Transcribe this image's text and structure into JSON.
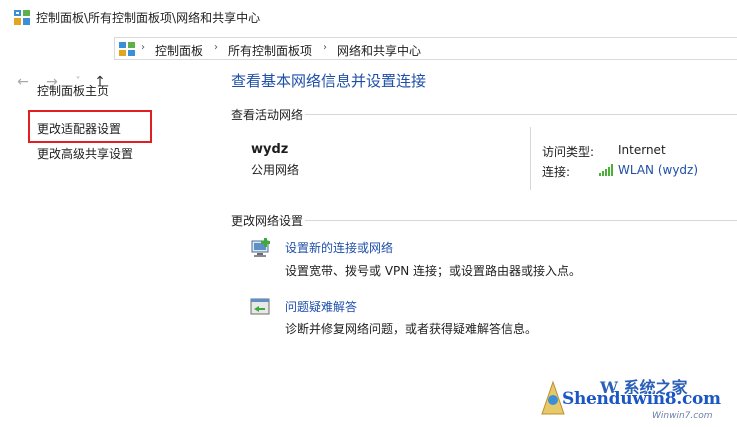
{
  "window": {
    "title": "控制面板\\所有控制面板项\\网络和共享中心"
  },
  "nav": {
    "back": "←",
    "forward": "→",
    "recent": "˅",
    "up": "↑"
  },
  "address": {
    "crumbs": [
      "控制面板",
      "所有控制面板项",
      "网络和共享中心"
    ],
    "separator": "›"
  },
  "sidebar": {
    "items": [
      "控制面板主页",
      "更改适配器设置",
      "更改高级共享设置"
    ]
  },
  "main": {
    "heading": "查看基本网络信息并设置连接",
    "active_label": "查看活动网络",
    "network": {
      "name": "wydz",
      "type": "公用网络",
      "access_label": "访问类型:",
      "access_value": "Internet",
      "conn_label": "连接:",
      "conn_value": "WLAN (wydz)"
    },
    "change_label": "更改网络设置",
    "tasks": [
      {
        "title": "设置新的连接或网络",
        "desc": "设置宽带、拨号或 VPN 连接；或设置路由器或接入点。"
      },
      {
        "title": "问题疑难解答",
        "desc": "诊断并修复网络问题，或者获得疑难解答信息。"
      }
    ]
  },
  "watermark": {
    "top": "W 系统之家",
    "main": "Shenduwin8.com",
    "sub": "Winwin7.com"
  },
  "colors": {
    "link": "#1e4fa8",
    "highlight": "#e02020"
  }
}
